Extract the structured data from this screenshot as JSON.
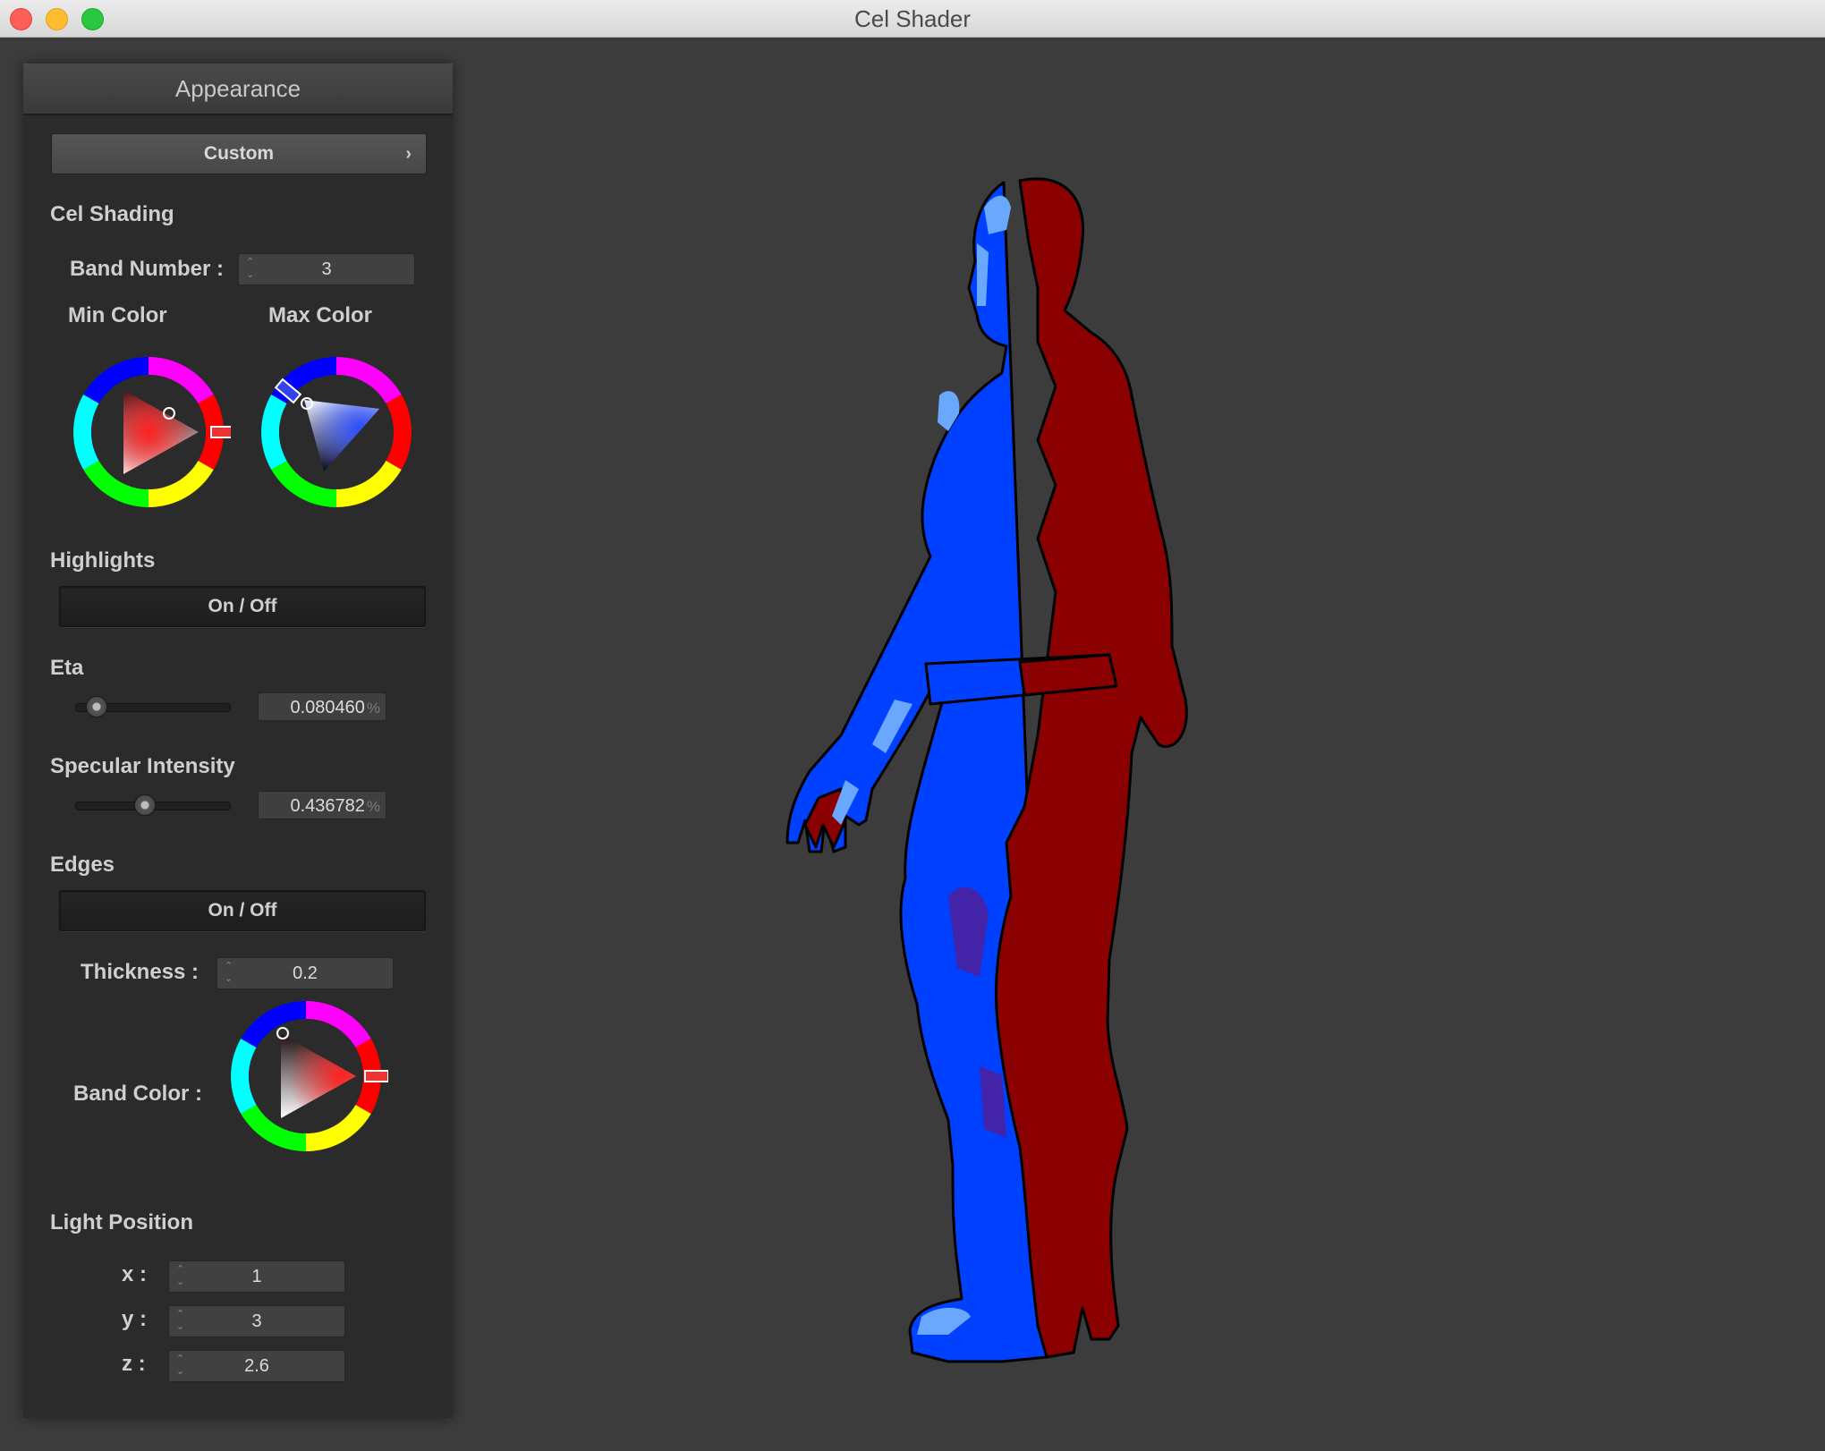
{
  "window": {
    "title": "Cel Shader"
  },
  "panel": {
    "header": "Appearance",
    "preset": {
      "label": "Custom",
      "chevron": "›"
    },
    "cel_shading": {
      "title": "Cel Shading",
      "band_number_label": "Band Number :",
      "band_number_value": "3",
      "min_color_label": "Min Color",
      "max_color_label": "Max Color",
      "min_color": "#ff0000",
      "max_color": "#0000ff"
    },
    "highlights": {
      "title": "Highlights",
      "toggle_label": "On / Off"
    },
    "eta": {
      "title": "Eta",
      "value": "0.080460",
      "unit": "%",
      "slider_fraction": 0.08
    },
    "specular": {
      "title": "Specular Intensity",
      "value": "0.436782",
      "unit": "%",
      "slider_fraction": 0.44
    },
    "edges": {
      "title": "Edges",
      "toggle_label": "On / Off",
      "thickness_label": "Thickness :",
      "thickness_value": "0.2",
      "band_color_label": "Band Color :",
      "band_color": "#ff0000"
    },
    "light_position": {
      "title": "Light Position",
      "x_label": "x :",
      "x_value": "1",
      "y_label": "y :",
      "y_value": "3",
      "z_label": "z :",
      "z_value": "2.6"
    }
  },
  "viewport": {
    "background": "#3c3c3c",
    "shade_light": "#0040ff",
    "shade_highlight": "#6aa8ff",
    "shade_dark": "#8b0000",
    "outline": "#000000"
  }
}
